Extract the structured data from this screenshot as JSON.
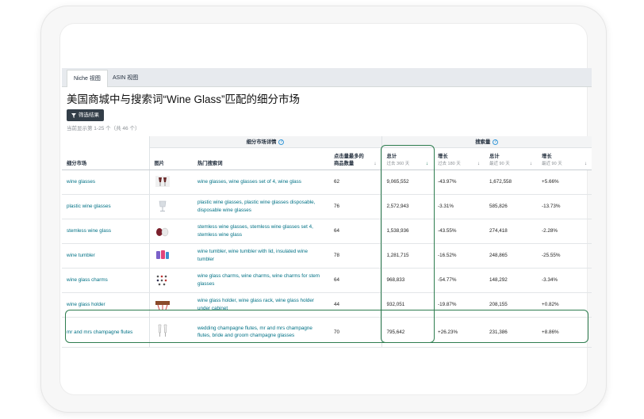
{
  "tabs": [
    {
      "label": "Niche 视图",
      "active": true
    },
    {
      "label": "ASIN 视图",
      "active": false
    }
  ],
  "title": "美国商城中与搜索词“Wine Glass”匹配的细分市场",
  "filter_button": {
    "label": "筛选结果",
    "icon": "funnel-icon"
  },
  "count_text": "当前显示第 1-25 个（共 46 个）",
  "table": {
    "group_headers": {
      "details": "细分市场详情",
      "search_volume": "搜索量"
    },
    "columns": {
      "niche": "细分市场",
      "image": "图片",
      "keywords": "热门搜索词",
      "clicked": "点击量最多的商品数量",
      "total1": "总计",
      "total1_sub": "过去 360 天",
      "growth1": "增长",
      "growth1_sub": "过去 180 天",
      "total2": "总计",
      "total2_sub": "最近 90 天",
      "growth2": "增长",
      "growth2_sub": "最近 90 天"
    },
    "rows": [
      {
        "niche": "wine glasses",
        "image": "wine-glass-set-thumbnail",
        "keywords": "wine glasses, wine glasses set of 4, wine glass",
        "clicked": "62",
        "total360": "9,065,552",
        "growth180": "-43.97%",
        "total90": "1,672,558",
        "growth90": "+5.66%"
      },
      {
        "niche": "plastic wine glasses",
        "image": "plastic-glass-thumbnail",
        "keywords": "plastic wine glasses, plastic wine glasses disposable, disposable wine glasses",
        "clicked": "76",
        "total360": "2,572,943",
        "growth180": "-3.31%",
        "total90": "585,826",
        "growth90": "-13.73%"
      },
      {
        "niche": "stemless wine glass",
        "image": "stemless-glass-thumbnail",
        "keywords": "stemless wine glasses, stemless wine glasses set 4, stemless wine glass",
        "clicked": "64",
        "total360": "1,538,936",
        "growth180": "-43.55%",
        "total90": "274,418",
        "growth90": "-2.28%"
      },
      {
        "niche": "wine tumbler",
        "image": "tumbler-thumbnail",
        "keywords": "wine tumbler, wine tumbler with lid, insulated wine tumbler",
        "clicked": "78",
        "total360": "1,281,715",
        "growth180": "-16.52%",
        "total90": "248,865",
        "growth90": "-25.55%"
      },
      {
        "niche": "wine glass charms",
        "image": "charms-thumbnail",
        "keywords": "wine glass charms, wine charms, wine charms for stem glasses",
        "clicked": "64",
        "total360": "968,833",
        "growth180": "-54.77%",
        "total90": "148,292",
        "growth90": "-3.34%"
      },
      {
        "niche": "wine glass holder",
        "image": "holder-thumbnail",
        "keywords": "wine glass holder, wine glass rack, wine glass holder under cabinet",
        "clicked": "44",
        "total360": "932,051",
        "growth180": "-19.87%",
        "total90": "208,155",
        "growth90": "+0.82%"
      },
      {
        "niche": "mr and mrs champagne flutes",
        "image": "flutes-thumbnail",
        "keywords": "wedding champagne flutes, mr and mrs champagne flutes, bride and groom champagne glasses",
        "clicked": "70",
        "total360": "795,642",
        "growth180": "+26.23%",
        "total90": "231,386",
        "growth90": "+8.86%"
      }
    ]
  },
  "colors": {
    "link": "#007185",
    "highlight": "#2e7d4f",
    "button": "#333e48"
  }
}
